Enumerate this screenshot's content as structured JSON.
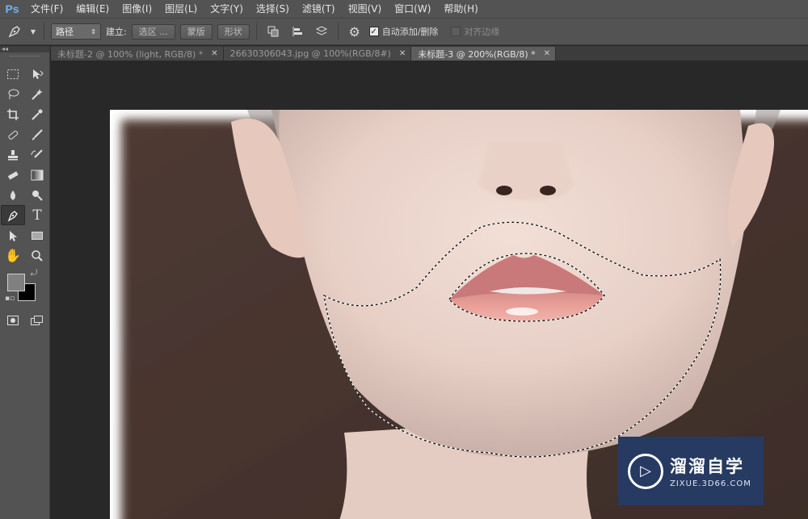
{
  "app": {
    "logo": "Ps"
  },
  "menu": [
    "文件(F)",
    "编辑(E)",
    "图像(I)",
    "图层(L)",
    "文字(Y)",
    "选择(S)",
    "滤镜(T)",
    "视图(V)",
    "窗口(W)",
    "帮助(H)"
  ],
  "options": {
    "tool_icon": "pen-icon",
    "mode_value": "路径",
    "make_label": "建立:",
    "selection_btn": "选区 ...",
    "mask_btn": "蒙版",
    "shape_btn": "形状",
    "auto_add_delete": "自动添加/删除",
    "auto_add_delete_checked": true,
    "align_edges": "对齐边缘",
    "align_edges_checked": false
  },
  "tabs": [
    {
      "label": "未标题-2 @ 100% (light, RGB/8) *",
      "active": false
    },
    {
      "label": "26630306043.jpg @ 100%(RGB/8#)",
      "active": false
    },
    {
      "label": "未标题-3 @ 200%(RGB/8) *",
      "active": true
    }
  ],
  "toolbox": {
    "collapse_glyph": "◂◂",
    "foreground_color": "#808080",
    "background_color": "#000000",
    "active_tool": "pen-tool"
  },
  "watermark": {
    "name": "溜溜自学",
    "url": "ZIXUE.3D66.COM"
  }
}
